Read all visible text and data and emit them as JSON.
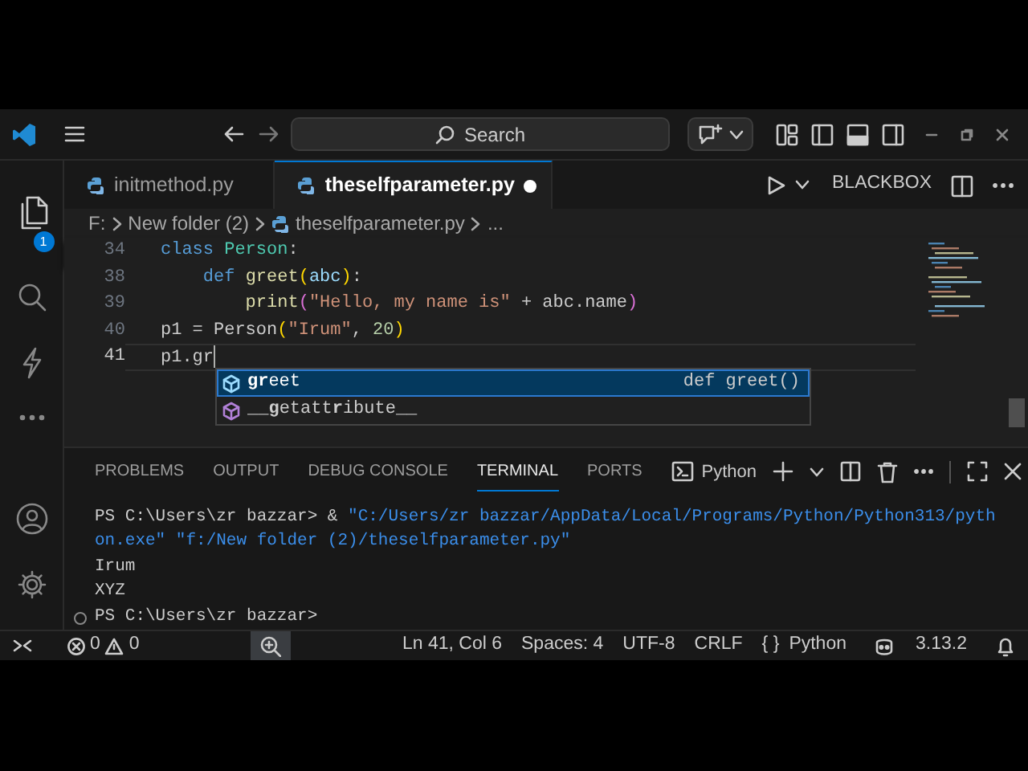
{
  "title_bar": {
    "search": "Search"
  },
  "activity_bar": {
    "explorer_badge": "1"
  },
  "tabs": [
    {
      "label": "initmethod.py",
      "selected": false,
      "modified": false
    },
    {
      "label": "theselfparameter.py",
      "selected": true,
      "modified": true
    }
  ],
  "editor_actions": {
    "label": "BLACKBOX"
  },
  "breadcrumb": [
    "F:",
    "New folder (2)",
    "theselfparameter.py",
    "..."
  ],
  "editor": {
    "sticky": {
      "number": "34",
      "tokens": [
        {
          "text": "class ",
          "color": "#569cd6"
        },
        {
          "text": "Person",
          "color": "#4ec9b0"
        },
        {
          "text": ":",
          "color": "#cccccc"
        }
      ]
    },
    "lines": [
      {
        "number": "38",
        "current": false,
        "tokens": [
          {
            "text": "    def ",
            "color": "#569cd6"
          },
          {
            "text": "greet",
            "color": "#dcdcaa"
          },
          {
            "text": "(",
            "color": "#ffd700"
          },
          {
            "text": "abc",
            "color": "#9cdcfe"
          },
          {
            "text": ")",
            "color": "#ffd700"
          },
          {
            "text": ":",
            "color": "#cccccc"
          }
        ]
      },
      {
        "number": "39",
        "current": false,
        "tokens": [
          {
            "text": "        print",
            "color": "#dcdcaa"
          },
          {
            "text": "(",
            "color": "#da70d6"
          },
          {
            "text": "\"Hello, my name is\"",
            "color": "#ce9178"
          },
          {
            "text": " + abc.name",
            "color": "#cccccc"
          },
          {
            "text": ")",
            "color": "#da70d6"
          }
        ]
      },
      {
        "number": "40",
        "current": false,
        "tokens": [
          {
            "text": "p1 = Person",
            "color": "#cccccc"
          },
          {
            "text": "(",
            "color": "#ffd700"
          },
          {
            "text": "\"Irum\"",
            "color": "#ce9178"
          },
          {
            "text": ", ",
            "color": "#cccccc"
          },
          {
            "text": "20",
            "color": "#b5cea8"
          },
          {
            "text": ")",
            "color": "#ffd700"
          }
        ]
      },
      {
        "number": "41",
        "current": true,
        "tokens": [
          {
            "text": "p1.gr",
            "color": "#cccccc"
          }
        ]
      }
    ]
  },
  "suggestions": [
    {
      "label": "**gr**eet",
      "detail": "def greet()",
      "selected": true
    },
    {
      "label": "__**g**etatt**r**ibute__",
      "selected": false
    }
  ],
  "panel": {
    "tabs": [
      {
        "label": "PROBLEMS",
        "selected": false
      },
      {
        "label": "OUTPUT",
        "selected": false
      },
      {
        "label": "DEBUG CONSOLE",
        "selected": false
      },
      {
        "label": "TERMINAL",
        "selected": true
      },
      {
        "label": "PORTS",
        "selected": false
      }
    ],
    "terminal_profile": "Python"
  },
  "terminal": {
    "lines": [
      {
        "tokens": [
          {
            "text": "PS C:\\Users\\zr bazzar> & ",
            "color": "#cccccc"
          },
          {
            "text": "\"C:/Users/zr bazzar/AppData/Local/Programs/Python/Python313/python.exe\"",
            "color": "#3b8eea"
          },
          {
            "text": " \"f:/New folder (2)/theselfparameter.py\"",
            "color": "#3b8eea"
          }
        ]
      },
      {
        "tokens": [
          {
            "text": "Irum",
            "color": "#cccccc"
          }
        ]
      },
      {
        "tokens": [
          {
            "text": "XYZ",
            "color": "#cccccc"
          }
        ]
      }
    ],
    "prompt": "PS C:\\Users\\zr bazzar>"
  },
  "status_bar": {
    "errors": "0",
    "warnings": "0",
    "items": [
      {
        "label": "Ln 41, Col 6"
      },
      {
        "label": "Spaces: 4"
      },
      {
        "label": "UTF-8"
      },
      {
        "label": "CRLF"
      },
      {
        "glyph": "{ }",
        "label": "Python"
      }
    ],
    "version": "3.13.2"
  }
}
